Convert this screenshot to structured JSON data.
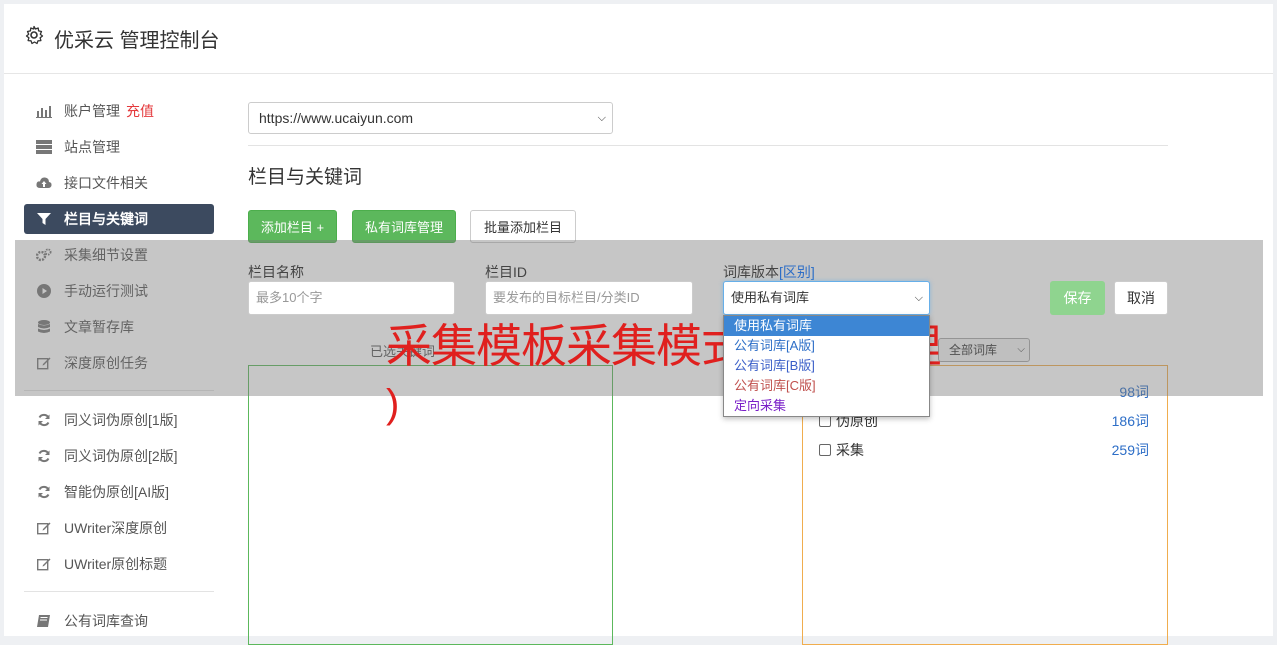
{
  "header": {
    "title": "优采云 管理控制台",
    "icon": "gear-icon"
  },
  "sidebar": {
    "group1": [
      {
        "label": "账户管理",
        "badge": "充值",
        "icon": "bar-chart-icon"
      },
      {
        "label": "站点管理",
        "icon": "server-icon"
      },
      {
        "label": "接口文件相关",
        "icon": "cloud-upload-icon"
      },
      {
        "label": "栏目与关键词",
        "icon": "filter-icon",
        "active": true
      },
      {
        "label": "采集细节设置",
        "icon": "cogs-icon"
      },
      {
        "label": "手动运行测试",
        "icon": "play-circle-icon"
      },
      {
        "label": "文章暂存库",
        "icon": "database-icon"
      },
      {
        "label": "深度原创任务",
        "icon": "edit-icon"
      }
    ],
    "group2": [
      {
        "label": "同义词伪原创[1版]",
        "icon": "refresh-icon"
      },
      {
        "label": "同义词伪原创[2版]",
        "icon": "refresh-icon"
      },
      {
        "label": "智能伪原创[AI版]",
        "icon": "refresh-icon"
      },
      {
        "label": "UWriter深度原创",
        "icon": "edit-icon"
      },
      {
        "label": "UWriter原创标题",
        "icon": "edit-icon"
      }
    ],
    "group3": [
      {
        "label": "公有词库查询",
        "icon": "book-icon"
      }
    ]
  },
  "site_select": {
    "value": "https://www.ucaiyun.com"
  },
  "section_title": "栏目与关键词",
  "buttons": {
    "add_column": "添加栏目 +",
    "private_lib": "私有词库管理",
    "batch_add": "批量添加栏目"
  },
  "form": {
    "name_label": "栏目名称",
    "name_placeholder": "最多10个字",
    "id_label": "栏目ID",
    "id_placeholder": "要发布的目标栏目/分类ID",
    "version_label": "词库版本",
    "version_label_link": "[区别]",
    "version_value": "使用私有词库",
    "save": "保存",
    "cancel": "取消"
  },
  "dropdown": {
    "options": [
      {
        "label": "使用私有词库",
        "selected": true,
        "color": "#ffffff"
      },
      {
        "label": "公有词库[A版]",
        "color": "#2d6ec7"
      },
      {
        "label": "公有词库[B版]",
        "color": "#3a5fc8"
      },
      {
        "label": "公有词库[C版]",
        "color": "#c0504d"
      },
      {
        "label": "定向采集",
        "color": "#7a1fc8"
      }
    ]
  },
  "hint_text": "已选关键词",
  "lib_filter": {
    "value": "全部词库"
  },
  "libraries": [
    {
      "name": "",
      "count": "98词"
    },
    {
      "name": "伪原创",
      "count": "186词"
    },
    {
      "name": "采集",
      "count": "259词"
    }
  ],
  "watermark": {
    "line1": "采集模板采集模式(图文处理",
    "line2": ")"
  }
}
